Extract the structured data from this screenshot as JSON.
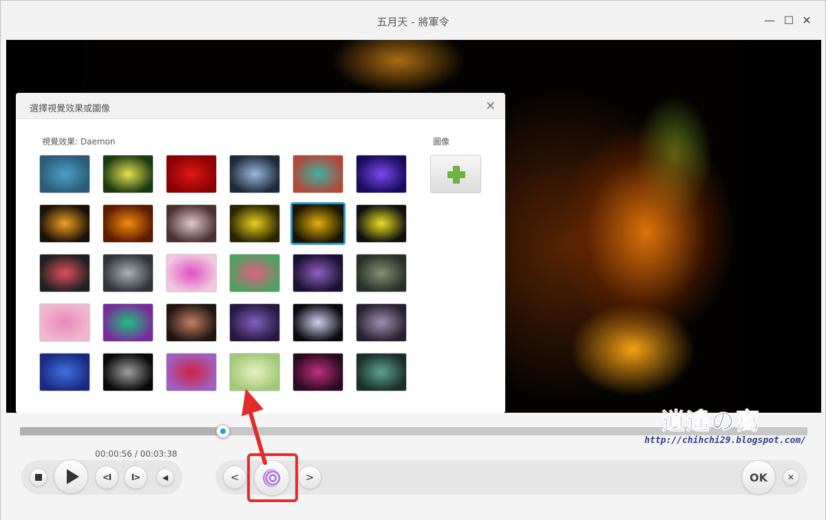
{
  "window": {
    "title": "五月天 - 將軍令",
    "minimize_glyph": "—",
    "maximize_glyph": "☐",
    "close_glyph": "✕"
  },
  "dialog": {
    "title": "選擇視覺效果或圖像",
    "close_glyph": "✕",
    "visualization_label": "視覺效果: Daemon",
    "image_label": "圖像",
    "selected_index": 10,
    "tile_colors": [
      [
        "#2b5b78",
        "#4aa0c8"
      ],
      [
        "#1a3a10",
        "#e7e050"
      ],
      [
        "#8a0000",
        "#e01818"
      ],
      [
        "#1c2a3a",
        "#9ab8d8"
      ],
      [
        "#b04a3a",
        "#40b0a0"
      ],
      [
        "#1a0a5a",
        "#7a4af0"
      ],
      [
        "#1a1008",
        "#f0a020"
      ],
      [
        "#5a1a00",
        "#f08a10"
      ],
      [
        "#4a3030",
        "#e0c8c8"
      ],
      [
        "#2a2400",
        "#e8d020"
      ],
      [
        "#1a1400",
        "#e0b010"
      ],
      [
        "#101010",
        "#e8e020"
      ],
      [
        "#202020",
        "#e05060"
      ],
      [
        "#303438",
        "#a8b0b8"
      ],
      [
        "#f0c8e0",
        "#e050c0"
      ],
      [
        "#50a060",
        "#e06080"
      ],
      [
        "#1a1030",
        "#9060c0"
      ],
      [
        "#283028",
        "#809070"
      ],
      [
        "#f0b8d0",
        "#e888b8"
      ],
      [
        "#7a2a9a",
        "#20c080"
      ],
      [
        "#201410",
        "#c08060"
      ],
      [
        "#281840",
        "#8060c0"
      ],
      [
        "#0a0a10",
        "#d0d0f0"
      ],
      [
        "#282030",
        "#a090b0"
      ],
      [
        "#1a2a80",
        "#4070e0"
      ],
      [
        "#080808",
        "#a0a0a0"
      ],
      [
        "#a060c0",
        "#d02040"
      ],
      [
        "#a0c878",
        "#e8f0c0"
      ],
      [
        "#2a0a20",
        "#c03080"
      ],
      [
        "#183028",
        "#60a090"
      ]
    ]
  },
  "playback": {
    "time": "00:00:56 / 00:03:38",
    "progress": 0.2578,
    "prev_label": "<",
    "next_label": ">",
    "skip_back_label": "<I",
    "skip_fwd_label": "I>",
    "ok_label": "OK",
    "cancel_glyph": "✕"
  },
  "watermark": {
    "title": "逍遙の窩",
    "url": "http://chihchi29.blogspot.com/"
  },
  "colors": {
    "accent": "#2a96d3",
    "highlight": "#e32b2b",
    "plus": "#6db33f"
  }
}
